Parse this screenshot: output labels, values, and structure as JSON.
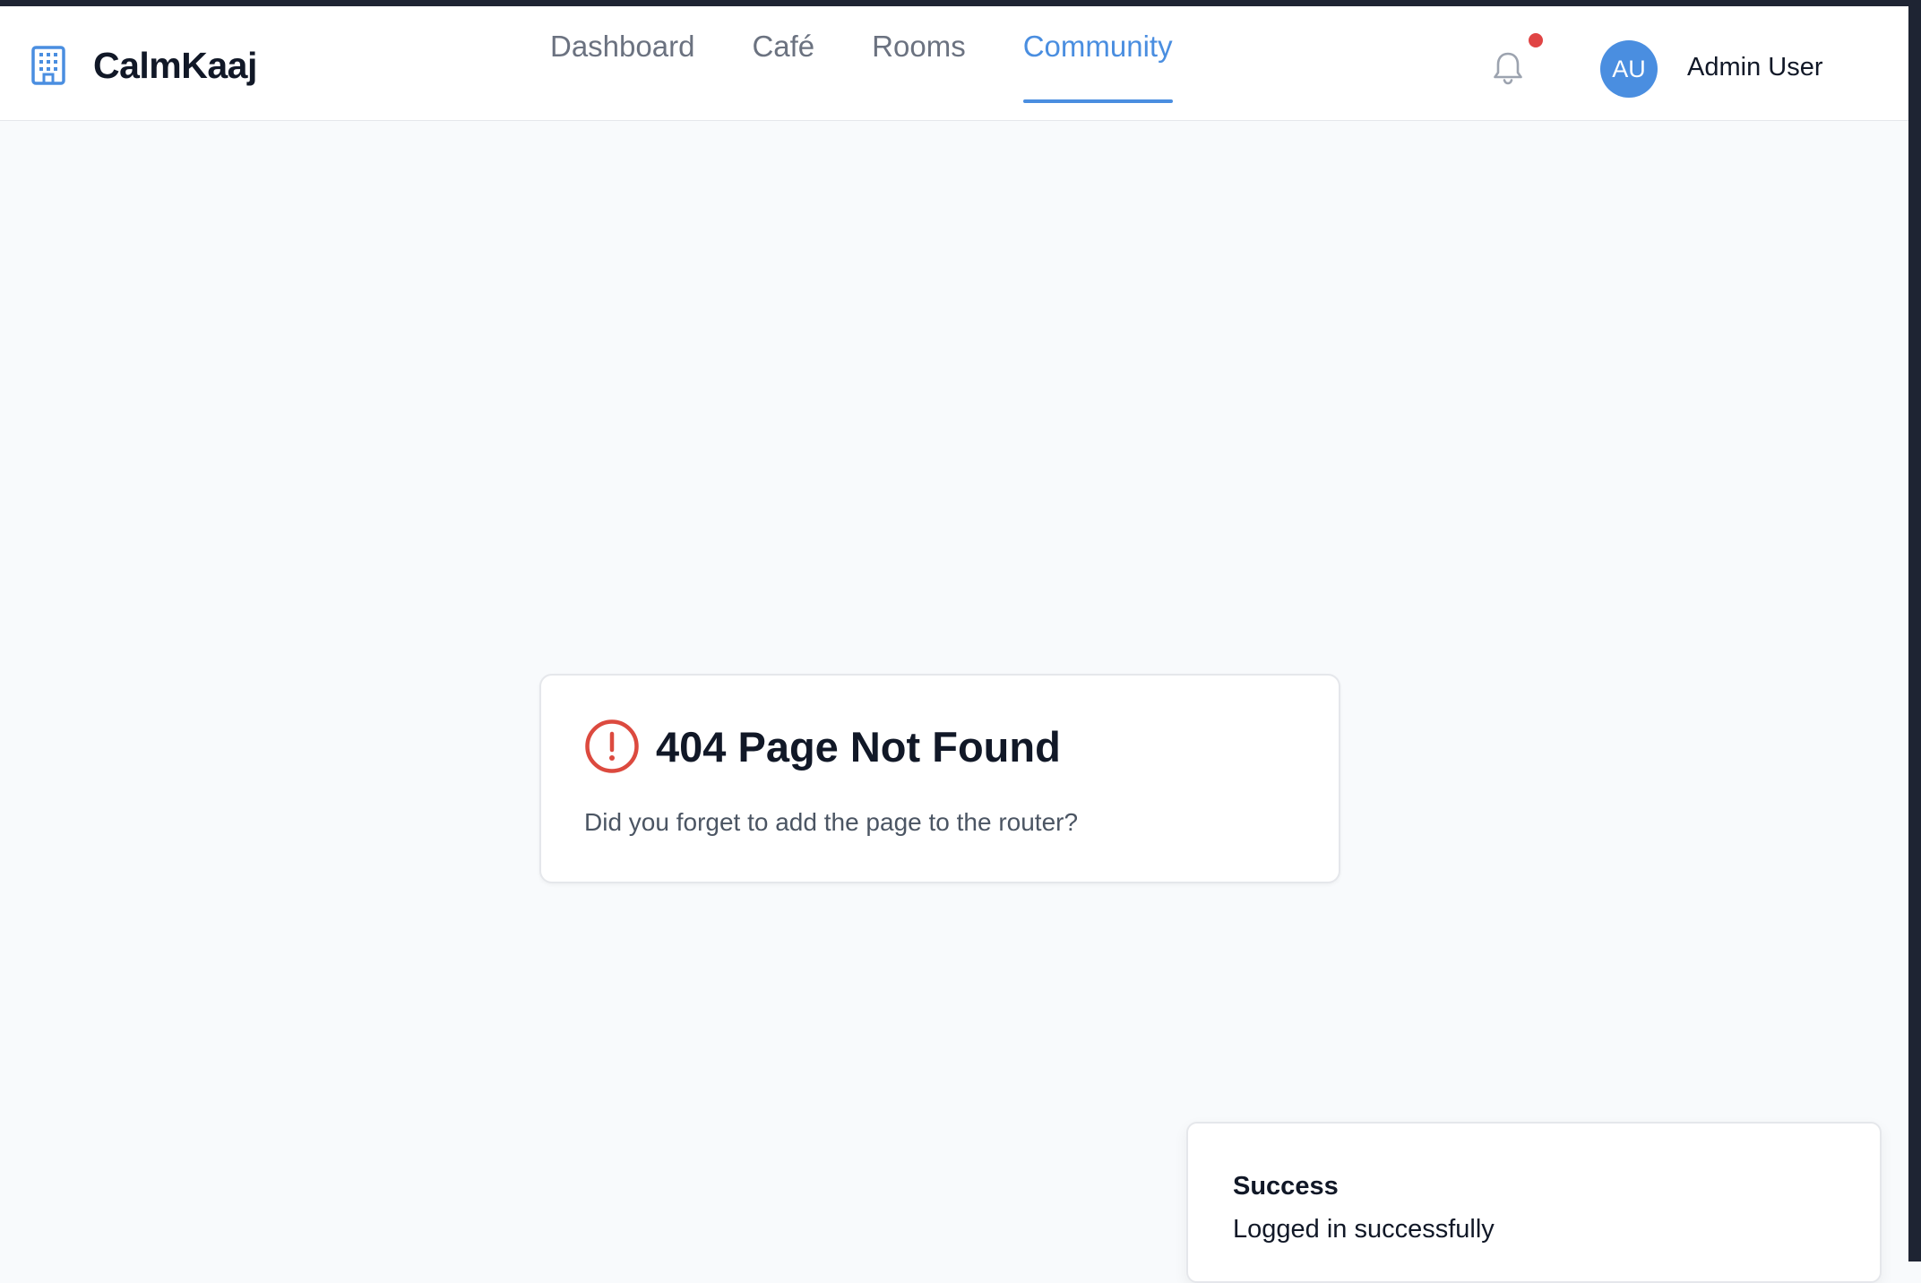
{
  "app": {
    "name": "CalmKaaj",
    "logo_icon": "building-icon",
    "accent_color": "#4a8ee0"
  },
  "nav": {
    "items": [
      {
        "label": "Dashboard",
        "active": false
      },
      {
        "label": "Café",
        "active": false
      },
      {
        "label": "Rooms",
        "active": false
      },
      {
        "label": "Community",
        "active": true
      }
    ]
  },
  "header": {
    "notification_icon": "bell-icon",
    "has_unread_notifications": true,
    "notification_dot_color": "#e04444",
    "user": {
      "initials": "AU",
      "name": "Admin User"
    }
  },
  "error": {
    "icon": "alert-circle-icon",
    "icon_color": "#dc4a3f",
    "title": "404 Page Not Found",
    "message": "Did you forget to add the page to the router?"
  },
  "toast": {
    "title": "Success",
    "message": "Logged in successfully"
  }
}
